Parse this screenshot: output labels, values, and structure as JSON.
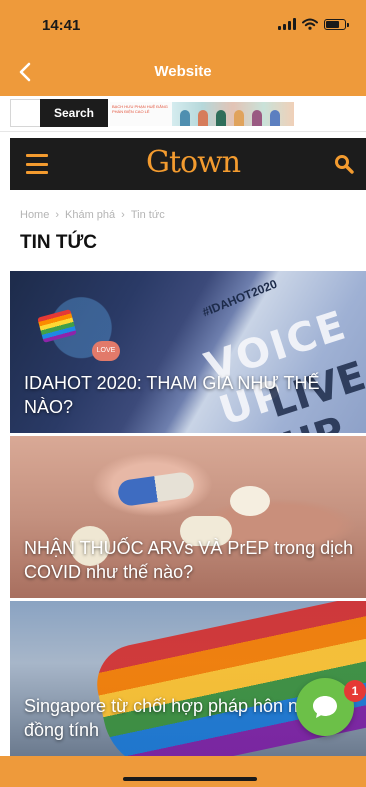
{
  "status_bar": {
    "time": "14:41",
    "icons": [
      "signal-icon",
      "wifi-icon",
      "battery-icon"
    ]
  },
  "nav": {
    "title": "Website",
    "back_icon": "chevron-left-icon"
  },
  "ad": {
    "search_label": "Search",
    "banner_text": "BẠCH HƯU PHẠN HUỆ ĐĂNG PHÁN ĐIỆN CAO LÊ"
  },
  "site_header": {
    "logo": "Gtown",
    "menu_icon": "hamburger-icon",
    "search_icon": "search-icon"
  },
  "breadcrumb": [
    "Home",
    "Khám phá",
    "Tin tức"
  ],
  "breadcrumb_separator": "›",
  "page_title": "TIN TỨC",
  "articles": [
    {
      "title": "IDAHOT 2020: THAM GIA NHƯ THẾ NÀO?",
      "image_text": {
        "line1": "VOICE UP",
        "line2": "LIVE UP",
        "stamp": "#IDAHOT2020",
        "badge": "LOVE"
      }
    },
    {
      "title": "NHẬN THUỐC ARVs VÀ PrEP trong dịch COVID như thế nào?"
    },
    {
      "title": "Singapore từ chối hợp pháp hôn nhân đồng tính"
    }
  ],
  "chat": {
    "badge_count": "1",
    "icon": "chat-bubble-icon"
  },
  "colors": {
    "brand_orange": "#ee9a3b",
    "logo_orange": "#f39b2f",
    "header_dark": "#1c1c1c",
    "chat_green": "#6cc048",
    "badge_red": "#e53935"
  }
}
